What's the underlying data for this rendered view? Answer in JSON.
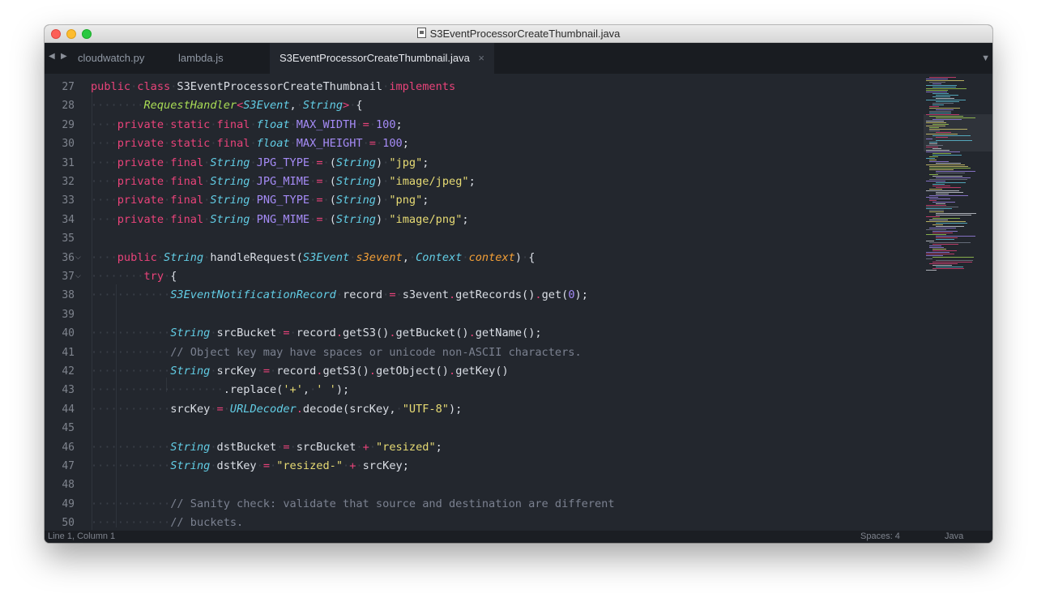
{
  "window": {
    "title": "S3EventProcessorCreateThumbnail.java"
  },
  "tabs": [
    {
      "label": "cloudwatch.py",
      "active": false
    },
    {
      "label": "lambda.js",
      "active": false
    },
    {
      "label": "S3EventProcessorCreateThumbnail.java",
      "active": true,
      "close_glyph": "×"
    }
  ],
  "tab_nav": {
    "left": "◀",
    "right": "▶",
    "menu": "▼"
  },
  "editor": {
    "lines": [
      {
        "n": "27",
        "segs": [
          [
            "kw",
            "public"
          ],
          [
            "dots",
            "·"
          ],
          [
            "kw",
            "class"
          ],
          [
            "dots",
            "·"
          ],
          [
            "fn",
            "S3EventProcessorCreateThumbnail"
          ],
          [
            "dots",
            "·"
          ],
          [
            "kw",
            "implements"
          ]
        ]
      },
      {
        "n": "28",
        "segs": [
          [
            "dots",
            "········"
          ],
          [
            "gtype",
            "RequestHandler"
          ],
          [
            "op",
            "<"
          ],
          [
            "type",
            "S3Event"
          ],
          [
            "fn",
            ","
          ],
          [
            "dots",
            "·"
          ],
          [
            "type",
            "String"
          ],
          [
            "op",
            ">"
          ],
          [
            "dots",
            "·"
          ],
          [
            "fn",
            "{"
          ]
        ]
      },
      {
        "n": "29",
        "segs": [
          [
            "dots",
            "····"
          ],
          [
            "kw",
            "private"
          ],
          [
            "dots",
            "·"
          ],
          [
            "kw",
            "static"
          ],
          [
            "dots",
            "·"
          ],
          [
            "kw",
            "final"
          ],
          [
            "dots",
            "·"
          ],
          [
            "type",
            "float"
          ],
          [
            "dots",
            "·"
          ],
          [
            "const",
            "MAX_WIDTH"
          ],
          [
            "dots",
            "·"
          ],
          [
            "op",
            "="
          ],
          [
            "dots",
            "·"
          ],
          [
            "num",
            "100"
          ],
          [
            "fn",
            ";"
          ]
        ]
      },
      {
        "n": "30",
        "segs": [
          [
            "dots",
            "····"
          ],
          [
            "kw",
            "private"
          ],
          [
            "dots",
            "·"
          ],
          [
            "kw",
            "static"
          ],
          [
            "dots",
            "·"
          ],
          [
            "kw",
            "final"
          ],
          [
            "dots",
            "·"
          ],
          [
            "type",
            "float"
          ],
          [
            "dots",
            "·"
          ],
          [
            "const",
            "MAX_HEIGHT"
          ],
          [
            "dots",
            "·"
          ],
          [
            "op",
            "="
          ],
          [
            "dots",
            "·"
          ],
          [
            "num",
            "100"
          ],
          [
            "fn",
            ";"
          ]
        ]
      },
      {
        "n": "31",
        "segs": [
          [
            "dots",
            "····"
          ],
          [
            "kw",
            "private"
          ],
          [
            "dots",
            "·"
          ],
          [
            "kw",
            "final"
          ],
          [
            "dots",
            "·"
          ],
          [
            "type",
            "String"
          ],
          [
            "dots",
            "·"
          ],
          [
            "const",
            "JPG_TYPE"
          ],
          [
            "dots",
            "·"
          ],
          [
            "op",
            "="
          ],
          [
            "dots",
            "·"
          ],
          [
            "fn",
            "("
          ],
          [
            "type",
            "String"
          ],
          [
            "fn",
            ")"
          ],
          [
            "dots",
            "·"
          ],
          [
            "str",
            "\"jpg\""
          ],
          [
            "fn",
            ";"
          ]
        ]
      },
      {
        "n": "32",
        "segs": [
          [
            "dots",
            "····"
          ],
          [
            "kw",
            "private"
          ],
          [
            "dots",
            "·"
          ],
          [
            "kw",
            "final"
          ],
          [
            "dots",
            "·"
          ],
          [
            "type",
            "String"
          ],
          [
            "dots",
            "·"
          ],
          [
            "const",
            "JPG_MIME"
          ],
          [
            "dots",
            "·"
          ],
          [
            "op",
            "="
          ],
          [
            "dots",
            "·"
          ],
          [
            "fn",
            "("
          ],
          [
            "type",
            "String"
          ],
          [
            "fn",
            ")"
          ],
          [
            "dots",
            "·"
          ],
          [
            "str",
            "\"image/jpeg\""
          ],
          [
            "fn",
            ";"
          ]
        ]
      },
      {
        "n": "33",
        "segs": [
          [
            "dots",
            "····"
          ],
          [
            "kw",
            "private"
          ],
          [
            "dots",
            "·"
          ],
          [
            "kw",
            "final"
          ],
          [
            "dots",
            "·"
          ],
          [
            "type",
            "String"
          ],
          [
            "dots",
            "·"
          ],
          [
            "const",
            "PNG_TYPE"
          ],
          [
            "dots",
            "·"
          ],
          [
            "op",
            "="
          ],
          [
            "dots",
            "·"
          ],
          [
            "fn",
            "("
          ],
          [
            "type",
            "String"
          ],
          [
            "fn",
            ")"
          ],
          [
            "dots",
            "·"
          ],
          [
            "str",
            "\"png\""
          ],
          [
            "fn",
            ";"
          ]
        ]
      },
      {
        "n": "34",
        "segs": [
          [
            "dots",
            "····"
          ],
          [
            "kw",
            "private"
          ],
          [
            "dots",
            "·"
          ],
          [
            "kw",
            "final"
          ],
          [
            "dots",
            "·"
          ],
          [
            "type",
            "String"
          ],
          [
            "dots",
            "·"
          ],
          [
            "const",
            "PNG_MIME"
          ],
          [
            "dots",
            "·"
          ],
          [
            "op",
            "="
          ],
          [
            "dots",
            "·"
          ],
          [
            "fn",
            "("
          ],
          [
            "type",
            "String"
          ],
          [
            "fn",
            ")"
          ],
          [
            "dots",
            "·"
          ],
          [
            "str",
            "\"image/png\""
          ],
          [
            "fn",
            ";"
          ]
        ]
      },
      {
        "n": "35",
        "segs": []
      },
      {
        "n": "36",
        "fold": "⌵",
        "segs": [
          [
            "dots",
            "····"
          ],
          [
            "kw",
            "public"
          ],
          [
            "dots",
            "·"
          ],
          [
            "type",
            "String"
          ],
          [
            "dots",
            "·"
          ],
          [
            "fn",
            "handleRequest("
          ],
          [
            "type",
            "S3Event"
          ],
          [
            "dots",
            "·"
          ],
          [
            "param",
            "s3event"
          ],
          [
            "fn",
            ","
          ],
          [
            "dots",
            "·"
          ],
          [
            "type",
            "Context"
          ],
          [
            "dots",
            "·"
          ],
          [
            "param",
            "context"
          ],
          [
            "fn",
            ")"
          ],
          [
            "dots",
            "·"
          ],
          [
            "fn",
            "{"
          ]
        ]
      },
      {
        "n": "37",
        "fold": "⌵",
        "segs": [
          [
            "dots",
            "········"
          ],
          [
            "kw",
            "try"
          ],
          [
            "dots",
            "·"
          ],
          [
            "fn",
            "{"
          ]
        ]
      },
      {
        "n": "38",
        "segs": [
          [
            "dots",
            "············"
          ],
          [
            "type",
            "S3EventNotificationRecord"
          ],
          [
            "dots",
            "·"
          ],
          [
            "fn",
            "record"
          ],
          [
            "dots",
            "·"
          ],
          [
            "op",
            "="
          ],
          [
            "dots",
            "·"
          ],
          [
            "fn",
            "s3event"
          ],
          [
            "op",
            "."
          ],
          [
            "fn",
            "getRecords()"
          ],
          [
            "op",
            "."
          ],
          [
            "fn",
            "get("
          ],
          [
            "num",
            "0"
          ],
          [
            "fn",
            ");"
          ]
        ]
      },
      {
        "n": "39",
        "segs": []
      },
      {
        "n": "40",
        "segs": [
          [
            "dots",
            "············"
          ],
          [
            "type",
            "String"
          ],
          [
            "dots",
            "·"
          ],
          [
            "fn",
            "srcBucket"
          ],
          [
            "dots",
            "·"
          ],
          [
            "op",
            "="
          ],
          [
            "dots",
            "·"
          ],
          [
            "fn",
            "record"
          ],
          [
            "op",
            "."
          ],
          [
            "fn",
            "getS3()"
          ],
          [
            "op",
            "."
          ],
          [
            "fn",
            "getBucket()"
          ],
          [
            "op",
            "."
          ],
          [
            "fn",
            "getName();"
          ]
        ]
      },
      {
        "n": "41",
        "segs": [
          [
            "dots",
            "············"
          ],
          [
            "com",
            "// Object key may have spaces or unicode non-ASCII characters."
          ]
        ]
      },
      {
        "n": "42",
        "segs": [
          [
            "dots",
            "············"
          ],
          [
            "type",
            "String"
          ],
          [
            "dots",
            "·"
          ],
          [
            "fn",
            "srcKey"
          ],
          [
            "dots",
            "·"
          ],
          [
            "op",
            "="
          ],
          [
            "dots",
            "·"
          ],
          [
            "fn",
            "record"
          ],
          [
            "op",
            "."
          ],
          [
            "fn",
            "getS3()"
          ],
          [
            "op",
            "."
          ],
          [
            "fn",
            "getObject()"
          ],
          [
            "op",
            "."
          ],
          [
            "fn",
            "getKey()"
          ]
        ]
      },
      {
        "n": "43",
        "segs": [
          [
            "dots",
            "····················"
          ],
          [
            "fn",
            ".replace("
          ],
          [
            "str",
            "'+'"
          ],
          [
            "fn",
            ","
          ],
          [
            "dots",
            "·"
          ],
          [
            "str",
            "' '"
          ],
          [
            "fn",
            ");"
          ]
        ]
      },
      {
        "n": "44",
        "segs": [
          [
            "dots",
            "············"
          ],
          [
            "fn",
            "srcKey"
          ],
          [
            "dots",
            "·"
          ],
          [
            "op",
            "="
          ],
          [
            "dots",
            "·"
          ],
          [
            "type",
            "URLDecoder"
          ],
          [
            "op",
            "."
          ],
          [
            "fn",
            "decode(srcKey,"
          ],
          [
            "dots",
            "·"
          ],
          [
            "str",
            "\"UTF-8\""
          ],
          [
            "fn",
            ");"
          ]
        ]
      },
      {
        "n": "45",
        "segs": []
      },
      {
        "n": "46",
        "segs": [
          [
            "dots",
            "············"
          ],
          [
            "type",
            "String"
          ],
          [
            "dots",
            "·"
          ],
          [
            "fn",
            "dstBucket"
          ],
          [
            "dots",
            "·"
          ],
          [
            "op",
            "="
          ],
          [
            "dots",
            "·"
          ],
          [
            "fn",
            "srcBucket"
          ],
          [
            "dots",
            "·"
          ],
          [
            "op",
            "+"
          ],
          [
            "dots",
            "·"
          ],
          [
            "str",
            "\"resized\""
          ],
          [
            "fn",
            ";"
          ]
        ]
      },
      {
        "n": "47",
        "segs": [
          [
            "dots",
            "············"
          ],
          [
            "type",
            "String"
          ],
          [
            "dots",
            "·"
          ],
          [
            "fn",
            "dstKey"
          ],
          [
            "dots",
            "·"
          ],
          [
            "op",
            "="
          ],
          [
            "dots",
            "·"
          ],
          [
            "str",
            "\"resized-\""
          ],
          [
            "dots",
            "·"
          ],
          [
            "op",
            "+"
          ],
          [
            "dots",
            "·"
          ],
          [
            "fn",
            "srcKey;"
          ]
        ]
      },
      {
        "n": "48",
        "segs": []
      },
      {
        "n": "49",
        "segs": [
          [
            "dots",
            "············"
          ],
          [
            "com",
            "// Sanity check: validate that source and destination are different"
          ]
        ]
      },
      {
        "n": "50",
        "segs": [
          [
            "dots",
            "············"
          ],
          [
            "com",
            "// buckets."
          ]
        ]
      }
    ]
  },
  "statusbar": {
    "position": "Line 1, Column 1",
    "indent": "Spaces: 4",
    "syntax": "Java"
  },
  "colors": {
    "keyword": "#e9437a",
    "type": "#62cde5",
    "generic": "#a9dc55",
    "constant": "#a58bf6",
    "string": "#e7db74",
    "comment": "#7b8190",
    "param": "#f39f37",
    "background": "#23272e"
  }
}
